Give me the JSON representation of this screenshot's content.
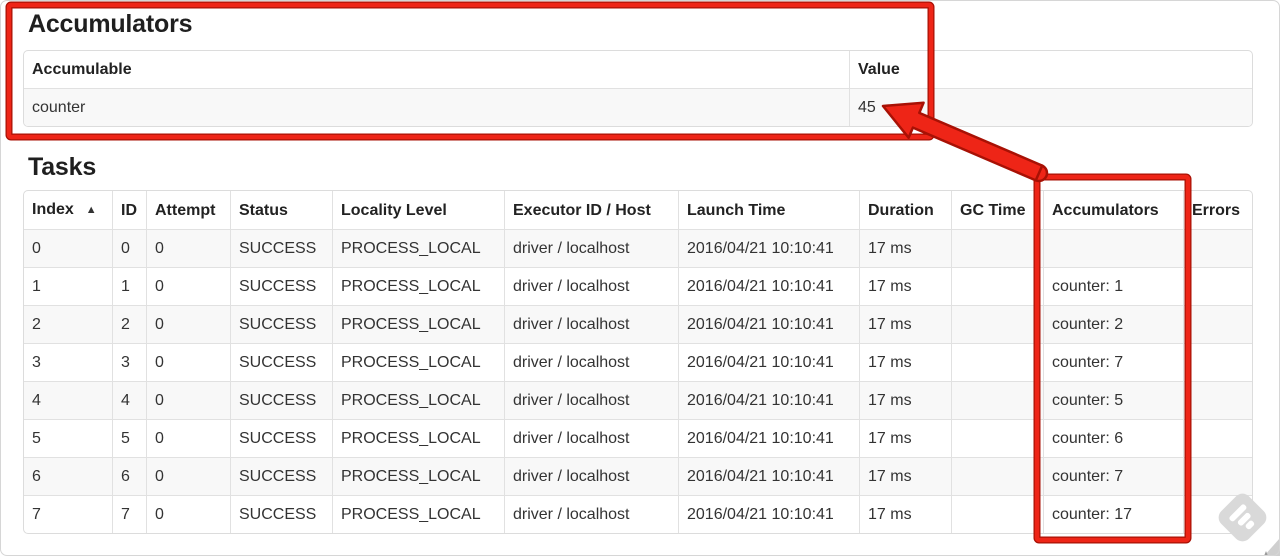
{
  "page": {
    "accumulators": {
      "title": "Accumulators",
      "headers": [
        "Accumulable",
        "Value"
      ],
      "rows": [
        [
          "counter",
          "45"
        ]
      ]
    },
    "tasks": {
      "title": "Tasks",
      "headers": [
        "Index",
        "ID",
        "Attempt",
        "Status",
        "Locality Level",
        "Executor ID / Host",
        "Launch Time",
        "Duration",
        "GC Time",
        "Accumulators",
        "Errors"
      ],
      "sort_icon": "▲",
      "rows": [
        [
          "0",
          "0",
          "0",
          "SUCCESS",
          "PROCESS_LOCAL",
          "driver / localhost",
          "2016/04/21 10:10:41",
          "17 ms",
          "",
          "",
          ""
        ],
        [
          "1",
          "1",
          "0",
          "SUCCESS",
          "PROCESS_LOCAL",
          "driver / localhost",
          "2016/04/21 10:10:41",
          "17 ms",
          "",
          "counter: 1",
          ""
        ],
        [
          "2",
          "2",
          "0",
          "SUCCESS",
          "PROCESS_LOCAL",
          "driver / localhost",
          "2016/04/21 10:10:41",
          "17 ms",
          "",
          "counter: 2",
          ""
        ],
        [
          "3",
          "3",
          "0",
          "SUCCESS",
          "PROCESS_LOCAL",
          "driver / localhost",
          "2016/04/21 10:10:41",
          "17 ms",
          "",
          "counter: 7",
          ""
        ],
        [
          "4",
          "4",
          "0",
          "SUCCESS",
          "PROCESS_LOCAL",
          "driver / localhost",
          "2016/04/21 10:10:41",
          "17 ms",
          "",
          "counter: 5",
          ""
        ],
        [
          "5",
          "5",
          "0",
          "SUCCESS",
          "PROCESS_LOCAL",
          "driver / localhost",
          "2016/04/21 10:10:41",
          "17 ms",
          "",
          "counter: 6",
          ""
        ],
        [
          "6",
          "6",
          "0",
          "SUCCESS",
          "PROCESS_LOCAL",
          "driver / localhost",
          "2016/04/21 10:10:41",
          "17 ms",
          "",
          "counter: 7",
          ""
        ],
        [
          "7",
          "7",
          "0",
          "SUCCESS",
          "PROCESS_LOCAL",
          "driver / localhost",
          "2016/04/21 10:10:41",
          "17 ms",
          "",
          "counter: 17",
          ""
        ]
      ]
    },
    "annotations": {
      "highlight_color": "#ee2517",
      "outline_color": "#a81105"
    },
    "watermark_icon": "skitch-icon"
  }
}
